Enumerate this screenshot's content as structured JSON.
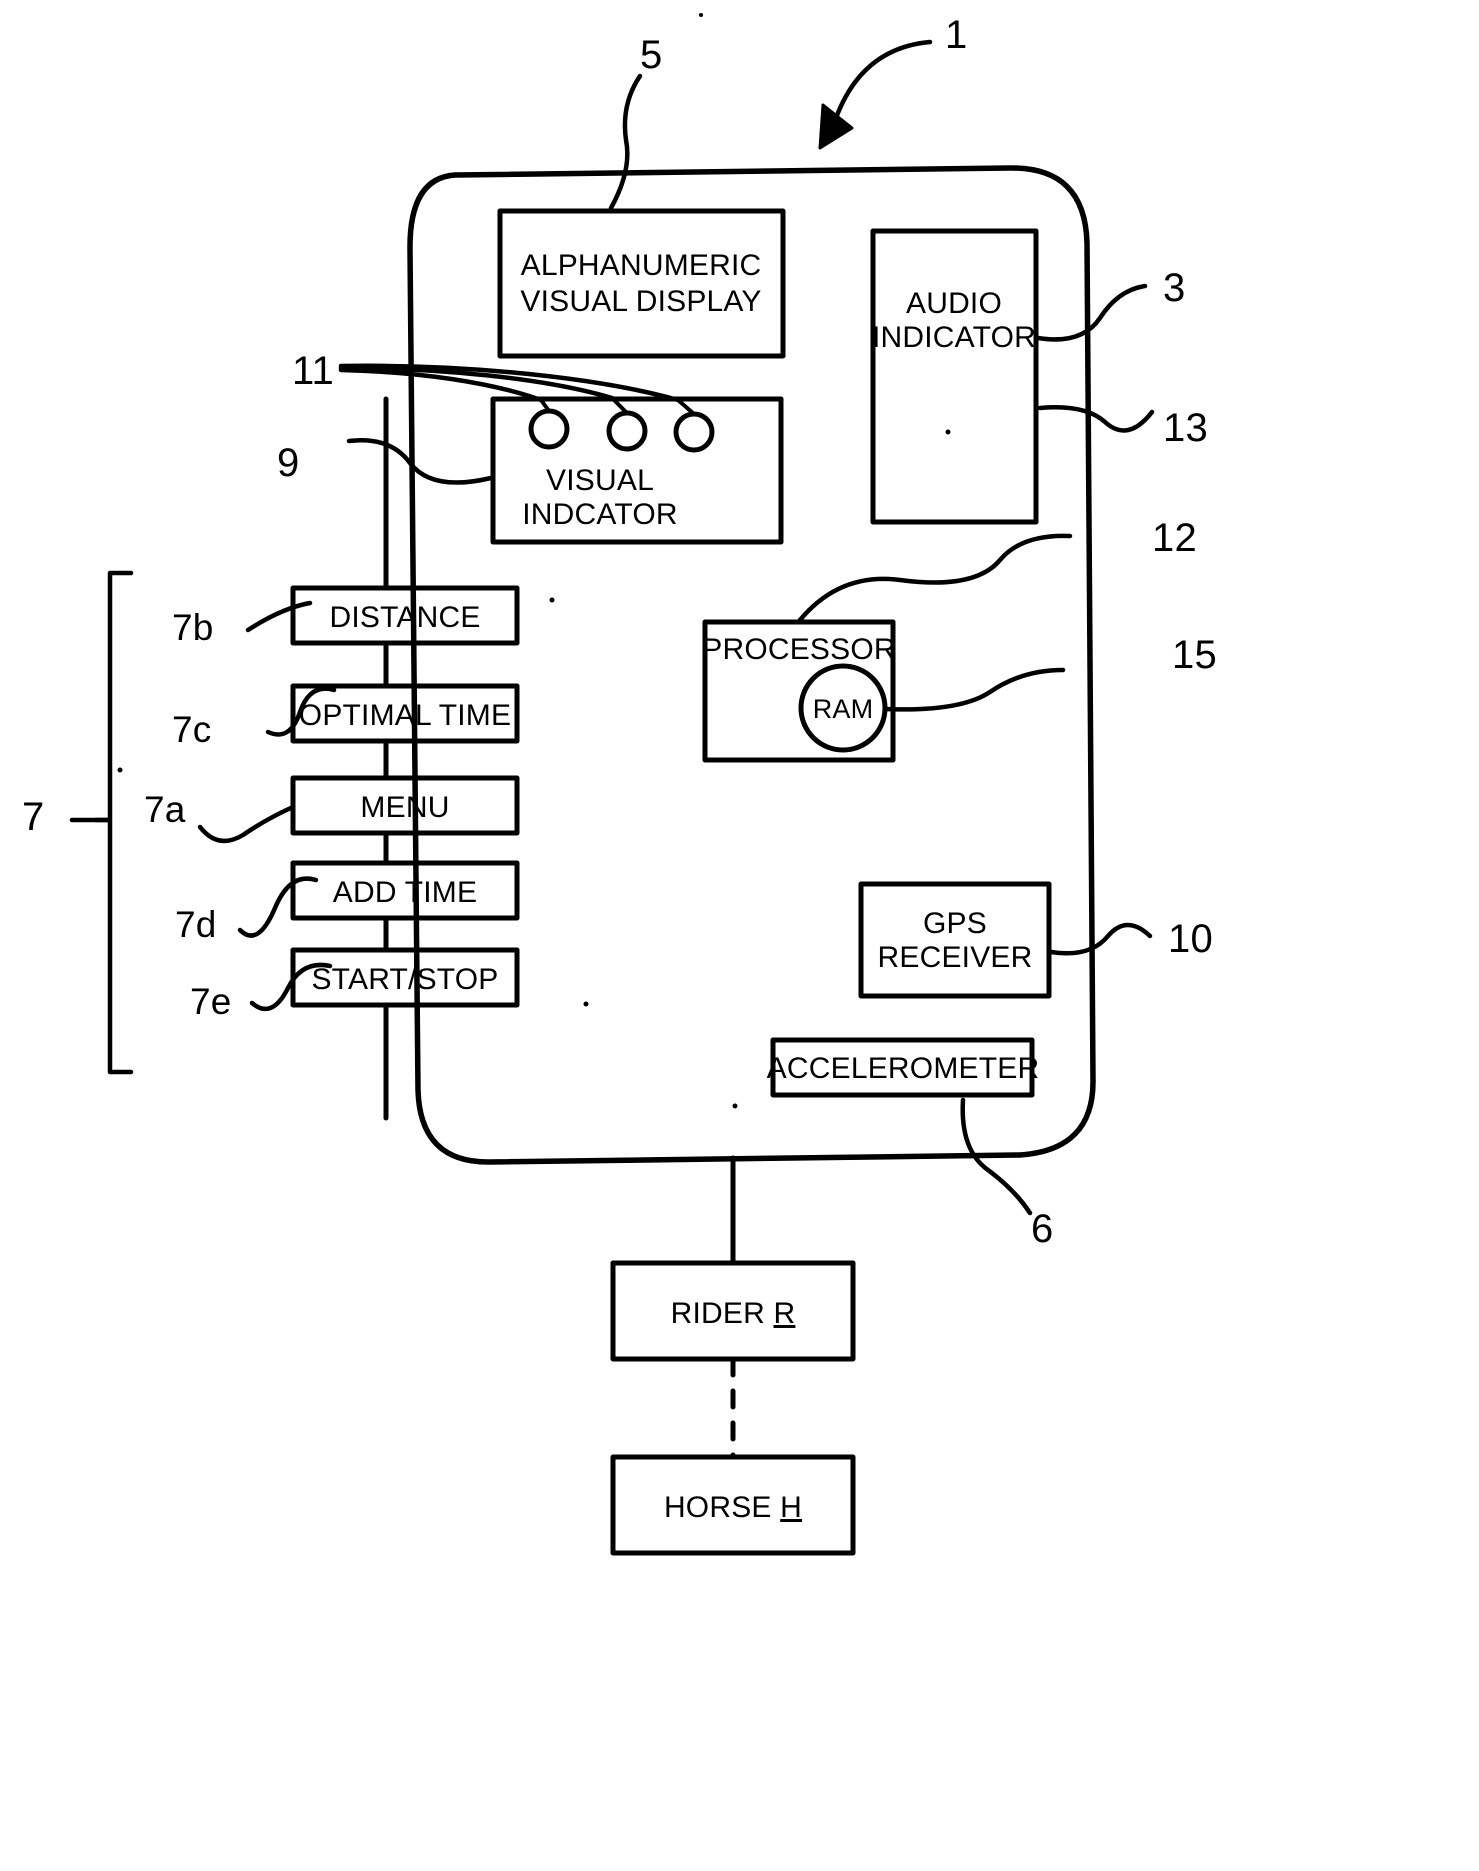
{
  "figure": {
    "type": "patent-block-diagram",
    "title_numeral": "1"
  },
  "blocks": {
    "display": {
      "line1": "ALPHANUMERIC",
      "line2": "VISUAL DISPLAY",
      "ref": "5"
    },
    "audio": {
      "line1": "AUDIO",
      "line2": "INDICATOR",
      "ref_right_top": "3",
      "ref_right_bottom": "13"
    },
    "visual": {
      "line1": "VISUAL",
      "line2": "INDCATOR",
      "ref": "9",
      "leader_ref": "11"
    },
    "processor": {
      "label": "PROCESSOR",
      "ref": "12"
    },
    "ram": {
      "label": "RAM",
      "ref": "15"
    },
    "gps": {
      "line1": "GPS",
      "line2": "RECEIVER",
      "ref": "10"
    },
    "accelerometer": {
      "label": "ACCELEROMETER",
      "ref": "6"
    },
    "rider": {
      "label": "RIDER",
      "suffix": "R"
    },
    "horse": {
      "label": "HORSE",
      "suffix": "H"
    }
  },
  "buttons": {
    "group_ref": "7",
    "items": [
      {
        "label": "DISTANCE",
        "ref": "7b"
      },
      {
        "label": "OPTIMAL TIME",
        "ref": "7c"
      },
      {
        "label": "MENU",
        "ref": "7a"
      },
      {
        "label": "ADD TIME",
        "ref": "7d"
      },
      {
        "label": "START/STOP",
        "ref": "7e"
      }
    ]
  },
  "indicator_lamps": {
    "count": 3,
    "ref": "11"
  },
  "colors": {
    "ink": "#000000",
    "paper": "#ffffff"
  }
}
